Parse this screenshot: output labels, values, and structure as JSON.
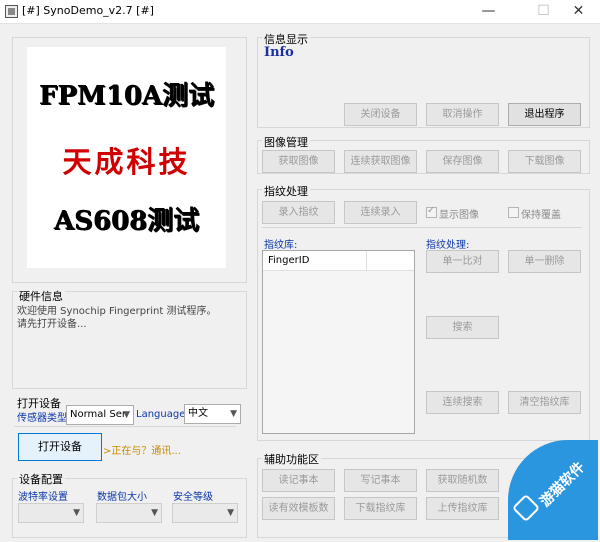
{
  "window": {
    "title": "[#] SynoDemo_v2.7 [#]",
    "minimize": "—",
    "maximize": "☐",
    "close": "✕"
  },
  "logo": {
    "line1": "FPM10A测试",
    "line2": "天成科技",
    "line3": "AS608测试"
  },
  "hardware": {
    "title": "硬件信息",
    "line1": "欢迎使用 Synochip Fingerprint 测试程序。",
    "line2": "请先打开设备..."
  },
  "open_device": {
    "title": "打开设备",
    "sensor_label": "传感器类型",
    "sensor_value": "Normal Ser",
    "language_label": "Language",
    "language_value": "中文",
    "open_button": "打开设备",
    "status": ">正在与？通讯..."
  },
  "device_config": {
    "title": "设备配置",
    "baud_label": "波特率设置",
    "packet_label": "数据包大小",
    "security_label": "安全等级"
  },
  "info_display": {
    "title": "信息显示",
    "message": "Info",
    "close_device": "关闭设备",
    "cancel": "取消操作",
    "exit": "退出程序"
  },
  "image_mgmt": {
    "title": "图像管理",
    "get_image": "获取图像",
    "continuous_get": "连续获取图像",
    "save_image": "保存图像",
    "download_image": "下载图像"
  },
  "fingerprint": {
    "title": "指纹处理",
    "enroll": "录入指纹",
    "continuous_enroll": "连续录入",
    "show_image": "显示图像",
    "keep_overlay": "保持覆盖",
    "library_label": "指纹库:",
    "library_column": "FingerID",
    "process_label": "指纹处理:",
    "match_one": "单一比对",
    "delete_one": "单一删除",
    "search": "搜索",
    "continuous_search": "连续搜索",
    "clear_library": "清空指纹库"
  },
  "aux": {
    "title": "辅助功能区",
    "read_notes": "读记事本",
    "write_notes": "写记事本",
    "get_random": "获取随机数",
    "read_valid_templates": "读有效模板数",
    "download_library": "下载指纹库",
    "upload_fingerprint": "上传指纹库"
  },
  "watermark": {
    "text": "游猫软件"
  }
}
